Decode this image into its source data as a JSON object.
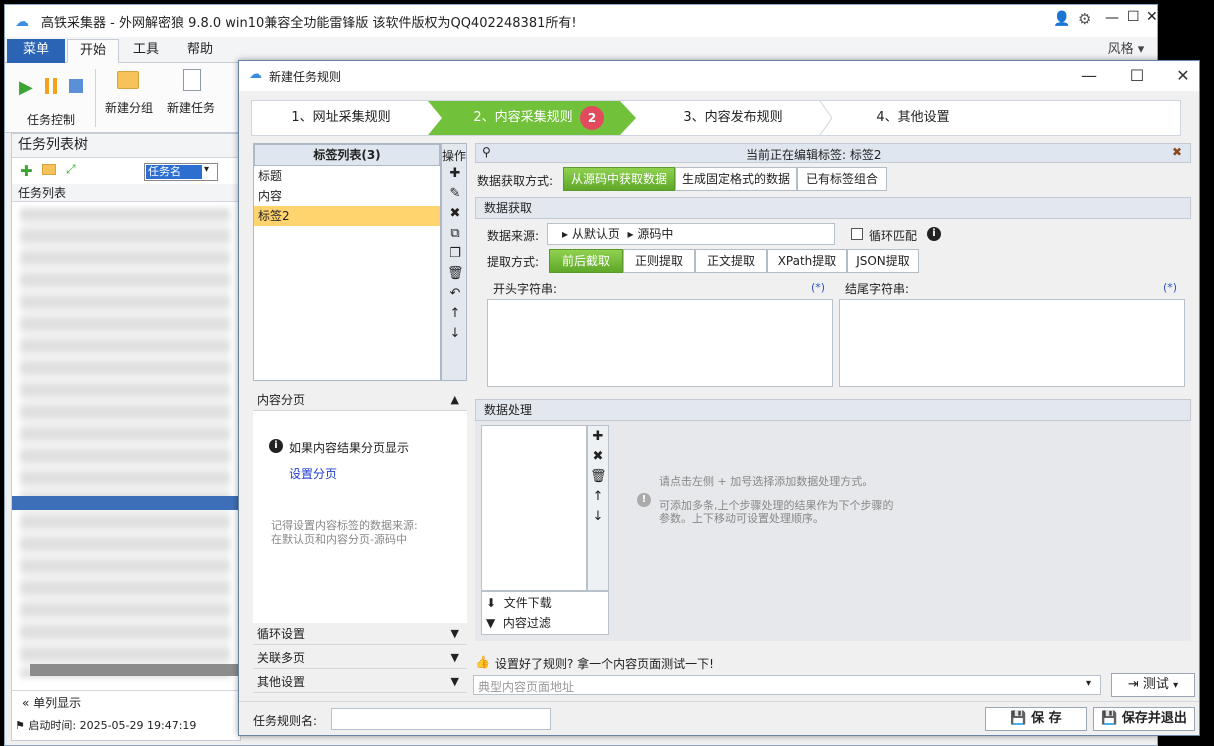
{
  "app": {
    "title": "高铁采集器 - 外网解密狼 9.8.0 win10兼容全功能雷锋版  该软件版权为QQ402248381所有!",
    "ribbon_tabs": [
      "菜单",
      "开始",
      "工具",
      "帮助"
    ],
    "style_label": "风格",
    "ribbon": {
      "task_control": "任务控制",
      "new_group": "新建分组",
      "new_task": "新建任务"
    },
    "tree": {
      "header": "任务列表树",
      "filter_value": "任务名",
      "list_header": "任务列表",
      "single_column": "单列显示"
    },
    "status": {
      "label": "启动时间:",
      "value": "2025-05-29 19:47:19"
    }
  },
  "dialog": {
    "title": "新建任务规则",
    "steps": [
      "1、网址采集规则",
      "2、内容采集规则",
      "3、内容发布规则",
      "4、其他设置"
    ],
    "active_step_badge": "2",
    "tag_list": {
      "header": "标签列表(3)",
      "ops_label": "操作",
      "items": [
        "标题",
        "内容",
        "标签2"
      ]
    },
    "pagination": {
      "header": "内容分页",
      "info": "如果内容结果分页显示",
      "link": "设置分页",
      "note": "记得设置内容标签的数据来源:\n在默认页和内容分页-源码中"
    },
    "collapsed": [
      "循环设置",
      "关联多页",
      "其他设置"
    ],
    "editing": "当前正在编辑标签: 标签2",
    "fetch_mode_label": "数据获取方式:",
    "fetch_modes": [
      "从源码中获取数据",
      "生成固定格式的数据",
      "已有标签组合"
    ],
    "data_fetch": {
      "header": "数据获取",
      "source_label": "数据来源:",
      "source_path": [
        "从默认页",
        "源码中"
      ],
      "loop_match": "循环匹配",
      "extract_label": "提取方式:",
      "extract_modes": [
        "前后截取",
        "正则提取",
        "正文提取",
        "XPath提取",
        "JSON提取"
      ],
      "start_label": "开头字符串:",
      "end_label": "结尾字符串:",
      "star": "(*)"
    },
    "processing": {
      "header": "数据处理",
      "actions": [
        "文件下载",
        "内容过滤"
      ],
      "hint1": "请点击左侧 + 加号选择添加数据处理方式。",
      "hint2": "可添加多条,上个步骤处理的结果作为下个步骤的\n参数。上下移动可设置处理顺序。"
    },
    "test": {
      "prompt": "设置好了规则? 拿一个内容页面测试一下!",
      "url_placeholder": "典型内容页面地址",
      "test_button": "测试"
    },
    "footer": {
      "name_label": "任务规则名:",
      "name_value": "",
      "save": "保 存",
      "save_exit": "保存并退出"
    }
  },
  "colors": {
    "accent_green": "#6dbb36",
    "selected_row": "#ffd36e",
    "badge_red": "#e24b5e"
  }
}
